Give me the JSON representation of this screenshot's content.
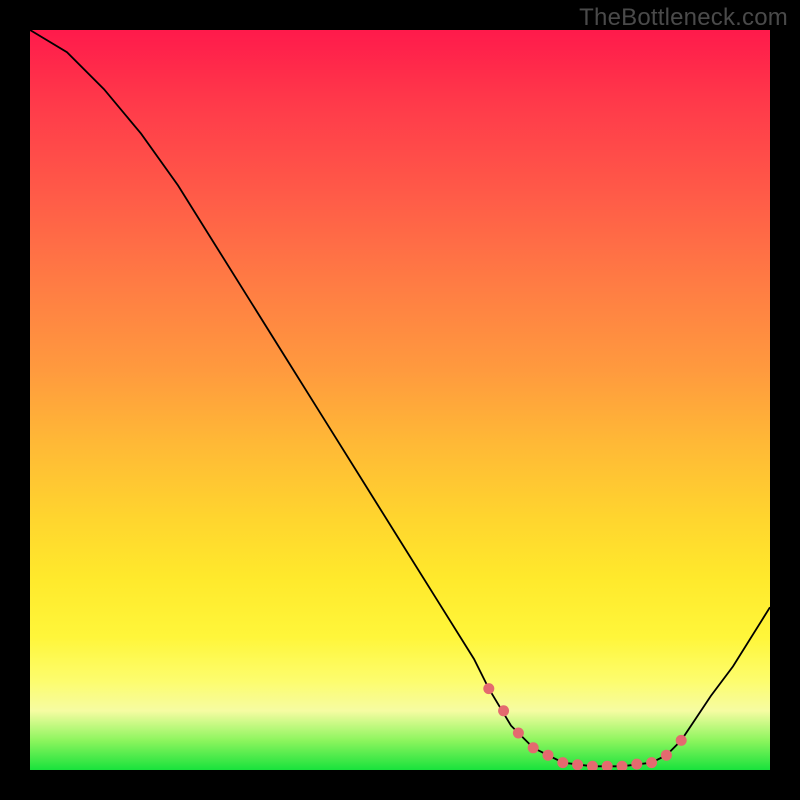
{
  "watermark": "TheBottleneck.com",
  "colors": {
    "background": "#000000",
    "curve": "#000000",
    "marker": "#e46a6f",
    "gradient_top": "#ff1a4b",
    "gradient_bottom": "#18e23c"
  },
  "chart_data": {
    "type": "line",
    "title": "",
    "xlabel": "",
    "ylabel": "",
    "xlim": [
      0,
      100
    ],
    "ylim": [
      0,
      100
    ],
    "series": [
      {
        "name": "bottleneck-curve",
        "x": [
          0,
          5,
          10,
          15,
          20,
          25,
          30,
          35,
          40,
          45,
          50,
          55,
          60,
          62,
          65,
          68,
          72,
          76,
          80,
          84,
          86,
          88,
          90,
          92,
          95,
          100
        ],
        "y": [
          100,
          97,
          92,
          86,
          79,
          71,
          63,
          55,
          47,
          39,
          31,
          23,
          15,
          11,
          6,
          3,
          1,
          0.5,
          0.5,
          1,
          2,
          4,
          7,
          10,
          14,
          22
        ]
      }
    ],
    "markers": {
      "name": "highlighted-segment",
      "x": [
        62,
        64,
        66,
        68,
        70,
        72,
        74,
        76,
        78,
        80,
        82,
        84,
        86,
        88
      ],
      "y": [
        11,
        8,
        5,
        3,
        2,
        1,
        0.7,
        0.5,
        0.5,
        0.5,
        0.8,
        1,
        2,
        4
      ]
    },
    "notes": "No axis ticks or numeric labels are rendered; values above are estimated on a 0–100 normalized scale by reading curve position off the gradient background."
  }
}
